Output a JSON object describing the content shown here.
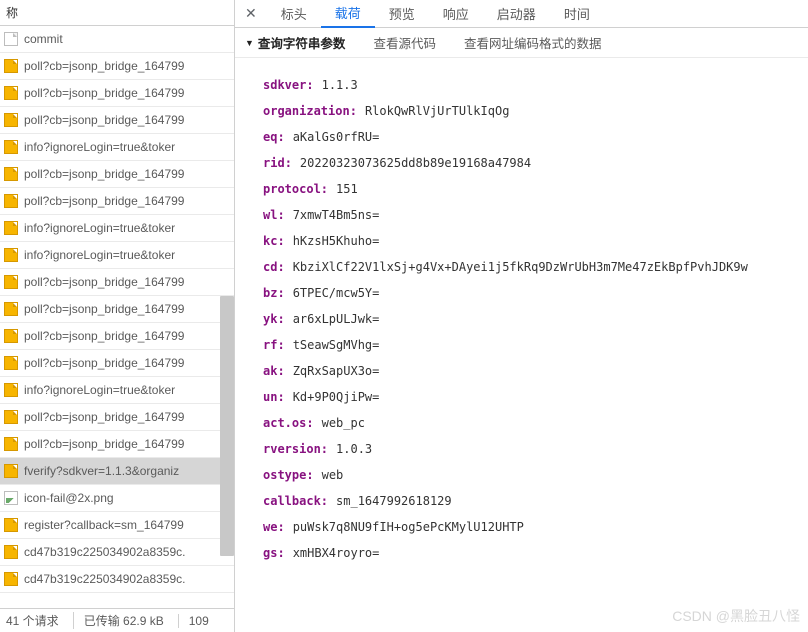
{
  "sidebar": {
    "header": "称",
    "items": [
      {
        "type": "doc",
        "label": "commit",
        "selected": false
      },
      {
        "type": "js",
        "label": "poll?cb=jsonp_bridge_164799",
        "selected": false
      },
      {
        "type": "js",
        "label": "poll?cb=jsonp_bridge_164799",
        "selected": false
      },
      {
        "type": "js",
        "label": "poll?cb=jsonp_bridge_164799",
        "selected": false
      },
      {
        "type": "js",
        "label": "info?ignoreLogin=true&toker",
        "selected": false
      },
      {
        "type": "js",
        "label": "poll?cb=jsonp_bridge_164799",
        "selected": false
      },
      {
        "type": "js",
        "label": "poll?cb=jsonp_bridge_164799",
        "selected": false
      },
      {
        "type": "js",
        "label": "info?ignoreLogin=true&toker",
        "selected": false
      },
      {
        "type": "js",
        "label": "info?ignoreLogin=true&toker",
        "selected": false
      },
      {
        "type": "js",
        "label": "poll?cb=jsonp_bridge_164799",
        "selected": false
      },
      {
        "type": "js",
        "label": "poll?cb=jsonp_bridge_164799",
        "selected": false
      },
      {
        "type": "js",
        "label": "poll?cb=jsonp_bridge_164799",
        "selected": false
      },
      {
        "type": "js",
        "label": "poll?cb=jsonp_bridge_164799",
        "selected": false
      },
      {
        "type": "js",
        "label": "info?ignoreLogin=true&toker",
        "selected": false
      },
      {
        "type": "js",
        "label": "poll?cb=jsonp_bridge_164799",
        "selected": false
      },
      {
        "type": "js",
        "label": "poll?cb=jsonp_bridge_164799",
        "selected": false
      },
      {
        "type": "js",
        "label": "fverify?sdkver=1.1.3&organiz",
        "selected": true
      },
      {
        "type": "img",
        "label": "icon-fail@2x.png",
        "selected": false
      },
      {
        "type": "js",
        "label": "register?callback=sm_164799",
        "selected": false
      },
      {
        "type": "js",
        "label": "cd47b319c225034902a8359c.",
        "selected": false
      },
      {
        "type": "js",
        "label": "cd47b319c225034902a8359c.",
        "selected": false
      }
    ]
  },
  "status": {
    "requests": "41 个请求",
    "transferred": "已传输 62.9 kB",
    "extra": "109"
  },
  "tabs": {
    "items": [
      "标头",
      "载荷",
      "预览",
      "响应",
      "启动器",
      "时间"
    ],
    "activeIndex": 1
  },
  "subbar": {
    "caret": "▼",
    "title": "查询字符串参数",
    "link1": "查看源代码",
    "link2": "查看网址编码格式的数据"
  },
  "payload": [
    {
      "k": "sdkver",
      "v": "1.1.3"
    },
    {
      "k": "organization",
      "v": "RlokQwRlVjUrTUlkIqOg"
    },
    {
      "k": "eq",
      "v": "aKalGs0rfRU="
    },
    {
      "k": "rid",
      "v": "20220323073625dd8b89e19168a47984"
    },
    {
      "k": "protocol",
      "v": "151"
    },
    {
      "k": "wl",
      "v": "7xmwT4Bm5ns="
    },
    {
      "k": "kc",
      "v": "hKzsH5Khuho="
    },
    {
      "k": "cd",
      "v": "KbziXlCf22V1lxSj+g4Vx+DAyei1j5fkRq9DzWrUbH3m7Me47zEkBpfPvhJDK9w"
    },
    {
      "k": "bz",
      "v": "6TPEC/mcw5Y="
    },
    {
      "k": "yk",
      "v": "ar6xLpULJwk="
    },
    {
      "k": "rf",
      "v": "tSeawSgMVhg="
    },
    {
      "k": "ak",
      "v": "ZqRxSapUX3o="
    },
    {
      "k": "un",
      "v": "Kd+9P0QjiPw="
    },
    {
      "k": "act.os",
      "v": "web_pc"
    },
    {
      "k": "rversion",
      "v": "1.0.3"
    },
    {
      "k": "ostype",
      "v": "web"
    },
    {
      "k": "callback",
      "v": "sm_1647992618129"
    },
    {
      "k": "we",
      "v": "puWsk7q8NU9fIH+og5ePcKMylU12UHTP"
    },
    {
      "k": "gs",
      "v": "xmHBX4royro="
    }
  ],
  "watermark": "CSDN @黑脸丑八怪"
}
